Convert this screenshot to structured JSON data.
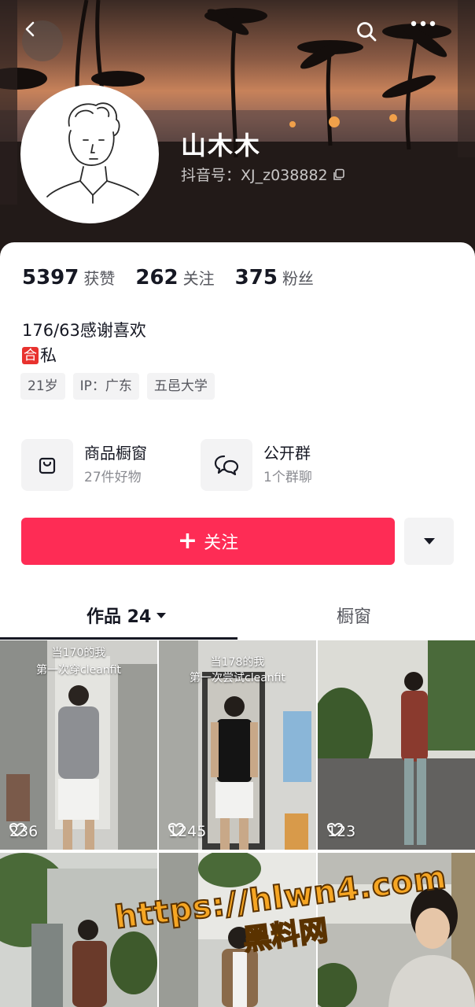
{
  "profile": {
    "nickname": "山木木",
    "douyin_id": "抖音号：XJ_z038882"
  },
  "stats": [
    {
      "value": "5397",
      "label": "获赞"
    },
    {
      "value": "262",
      "label": "关注"
    },
    {
      "value": "375",
      "label": "粉丝"
    }
  ],
  "bio": {
    "line1": "176/63感谢喜欢",
    "badge": "合",
    "line2": "私"
  },
  "tags": [
    "21岁",
    "IP：广东",
    "五邑大学"
  ],
  "services": [
    {
      "title": "商品橱窗",
      "sub": "27件好物",
      "icon": "shopping-bag-icon"
    },
    {
      "title": "公开群",
      "sub": "1个群聊",
      "icon": "group-chat-icon"
    }
  ],
  "actions": {
    "follow_plus": "+",
    "follow_label": "关注"
  },
  "tabs": {
    "works": "作品 24",
    "shop": "橱窗"
  },
  "videos": [
    {
      "caption1": "当170的我",
      "caption2": "第一次穿cleanfit",
      "likes": "236"
    },
    {
      "caption1": "当178的我",
      "caption2": "第一次尝试cleanfit",
      "likes": "1245"
    },
    {
      "caption1": "",
      "caption2": "",
      "likes": "123"
    }
  ],
  "watermark": {
    "url": "https://hlwn4.com",
    "name": "黑料网"
  },
  "colors": {
    "accent": "#fe2c55",
    "badge": "#e8322e",
    "text_primary": "#161823",
    "text_secondary": "#56575e"
  }
}
